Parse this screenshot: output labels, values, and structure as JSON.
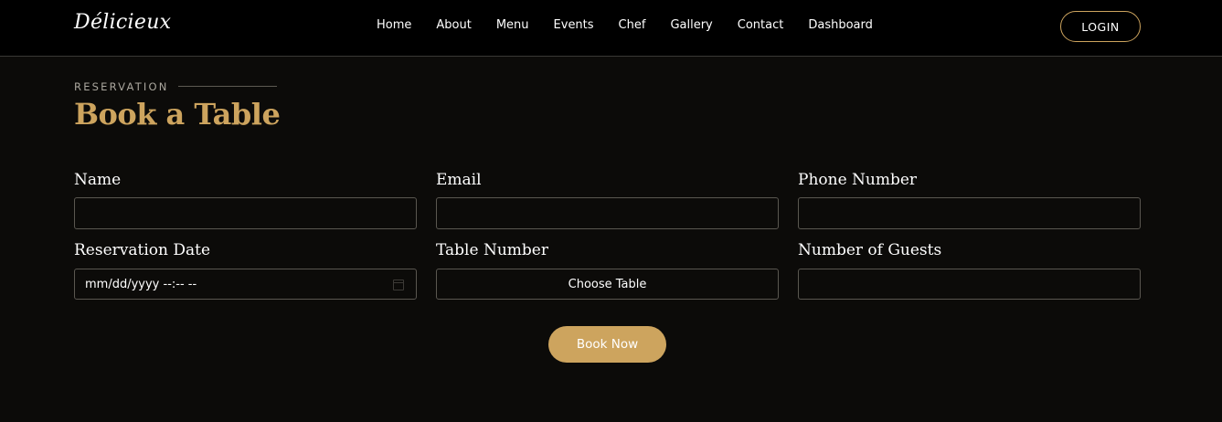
{
  "nav": {
    "brand": "Délicieux",
    "links": [
      "Home",
      "About",
      "Menu",
      "Events",
      "Chef",
      "Gallery",
      "Contact",
      "Dashboard"
    ],
    "login_label": "LOGIN"
  },
  "section": {
    "eyebrow": "RESERVATION",
    "title": "Book a Table"
  },
  "form": {
    "name_label": "Name",
    "email_label": "Email",
    "phone_label": "Phone Number",
    "date_label": "Reservation Date",
    "date_placeholder": "mm/dd/yyyy --:-- --",
    "table_label": "Table Number",
    "table_selected": "Choose Table",
    "guests_label": "Number of Guests",
    "submit_label": "Book Now"
  },
  "colors": {
    "accent": "#cda45e",
    "background": "#0c0b09",
    "navbar": "#000000"
  },
  "icons": {
    "date_picker": "calendar-icon"
  }
}
